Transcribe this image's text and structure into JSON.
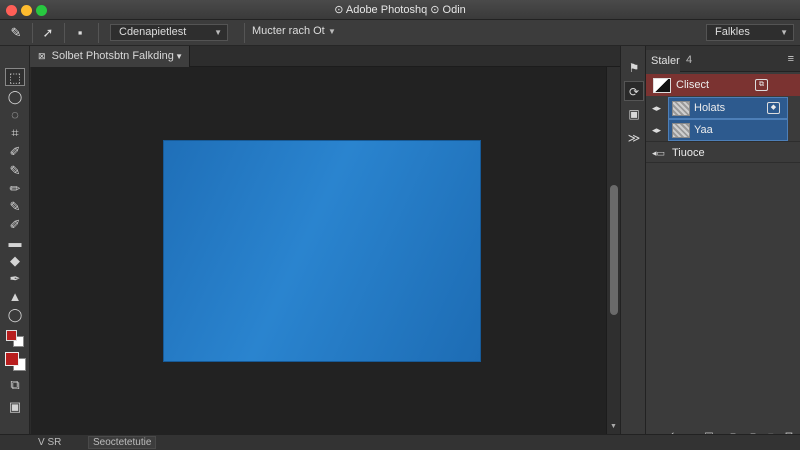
{
  "window": {
    "title": "⊙ Adobe Photoshq ⊙ Odin"
  },
  "options_bar": {
    "preset_dropdown": "Cdenapietlest",
    "mode_dropdown": "Mucter rach Ot",
    "workspace_dropdown": "Falkles",
    "icons": [
      "brush-icon",
      "move-tool-icon",
      "tool-preset-icon"
    ]
  },
  "document": {
    "tab_label": "Solbet Photsbtn Falkding",
    "canvas_fill": "#2277c4"
  },
  "tools": [
    "marquee-icon",
    "lasso-icon",
    "quick-select-icon",
    "crop-icon",
    "eyedropper-icon",
    "healing-brush-icon",
    "brush-icon",
    "clone-stamp-icon",
    "eraser-icon",
    "gradient-icon",
    "dodge-icon",
    "pen-icon",
    "type-icon",
    "shape-icon",
    "hand-icon",
    "zoom-icon"
  ],
  "colors": {
    "foreground": "#b81e1e",
    "background": "#ffffff",
    "layer_selected": "#2d5a8e",
    "layer_active_red": "#7b3331"
  },
  "layers_panel": {
    "tab_label": "Staler",
    "tab_extra": "4",
    "layers": [
      {
        "name": "Clisect",
        "highlight": "red"
      },
      {
        "name": "Holats",
        "highlight": "blue"
      },
      {
        "name": "Yaa",
        "highlight": "blue"
      },
      {
        "name": "Tiuoce",
        "highlight": "none"
      }
    ],
    "bottom_buttons": [
      "link-layers-icon",
      "fx-icon",
      "mask-icon",
      "adjustment-icon",
      "group-icon",
      "new-layer-icon",
      "delete-layer-icon"
    ]
  },
  "status_bar": {
    "left_text": "V SR",
    "doc_info": "Seoctetetutie"
  }
}
